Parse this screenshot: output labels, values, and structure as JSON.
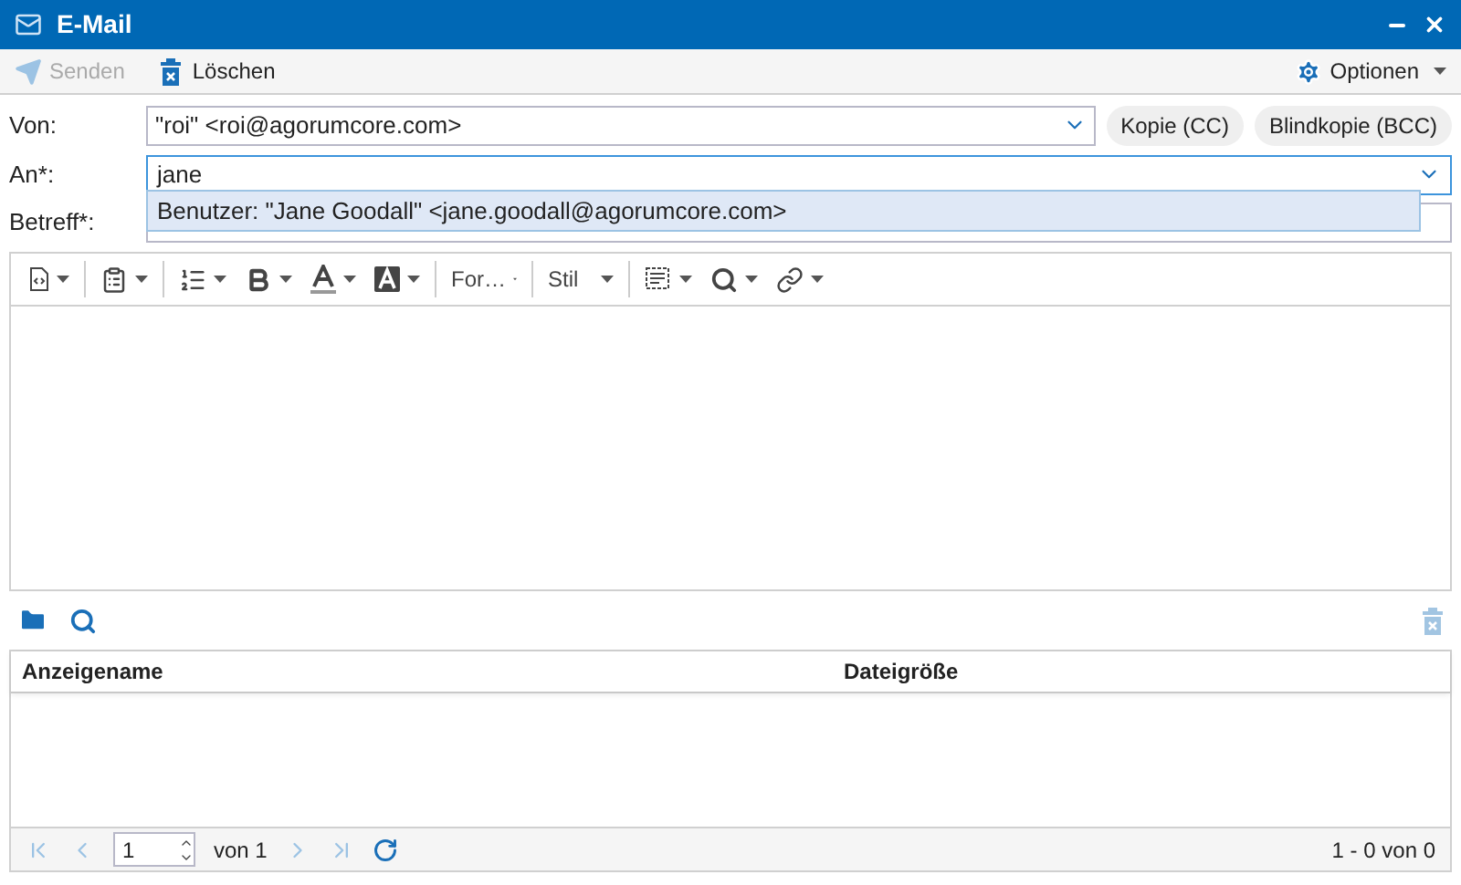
{
  "window": {
    "title": "E-Mail"
  },
  "toolbar": {
    "send": {
      "label": "Senden",
      "disabled": true
    },
    "delete": {
      "label": "Löschen",
      "disabled": false
    },
    "options": {
      "label": "Optionen"
    }
  },
  "form": {
    "from": {
      "label": "Von:",
      "value": "\"roi\" <roi@agorumcore.com>"
    },
    "cc_button": "Kopie (CC)",
    "bcc_button": "Blindkopie (BCC)",
    "to": {
      "label": "An*:",
      "value": "jane",
      "focused": true
    },
    "suggestions": [
      {
        "text": "Benutzer: \"Jane Goodall\" <jane.goodall@agorumcore.com>",
        "selected": true
      }
    ],
    "subject": {
      "label": "Betreff*:"
    }
  },
  "editor_toolbar": {
    "format_combo": "For…",
    "style_combo": "Stil"
  },
  "attachments": {
    "remove_disabled": true,
    "columns": [
      "Anzeigename",
      "Dateigröße"
    ],
    "pager": {
      "page": "1",
      "of": "von 1",
      "summary": "1 - 0 von 0",
      "first_disabled": true,
      "last_disabled": true
    }
  }
}
